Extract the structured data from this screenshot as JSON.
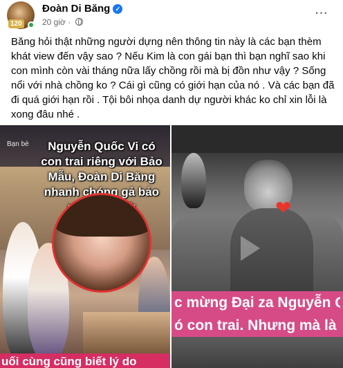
{
  "post": {
    "author": "Đoàn Di Băng",
    "avatar_badge": "120",
    "time": "20 giờ",
    "more_label": "···",
    "text": "Băng hỏi thật những người dựng nên thông tin này là các bạn thèm khát view đến vậy sao ? Nếu Kim là con gái bạn thì bạn nghĩ sao khi con mình còn vài tháng nữa lấy chồng rồi mà bị đồn như vậy ? Sống nổi với nhà chồng ko ? Cái gì cũng có giới hạn của nó . Và các bạn đã đi quá giới hạn rồi . Tội bôi nhọa danh dự người khác ko chỉ xin lỗi là xong đâu nhé ."
  },
  "media": {
    "left": {
      "friends_label": "Bạn bè",
      "headline": "Nguyễn Quốc Vi có con trai riêng với Bảo Mẫu, Đoàn Di Băng nhanh chóng gả bảo mẫu theo ck",
      "caption": "uối cùng cũng biết lý do"
    },
    "right": {
      "caption_line1": "c mừng Đại za Nguyễn Q",
      "caption_line2": "ó con trai. Nhưng mà là"
    }
  },
  "colors": {
    "verified": "#1877f2",
    "online": "#31a24c",
    "left_caption_bg": "#d62d63",
    "right_caption_bg": "#d64b86",
    "heart": "#e8342b"
  },
  "icons": [
    "verified-badge-icon",
    "globe-icon",
    "more-options-icon",
    "heart-icon"
  ]
}
